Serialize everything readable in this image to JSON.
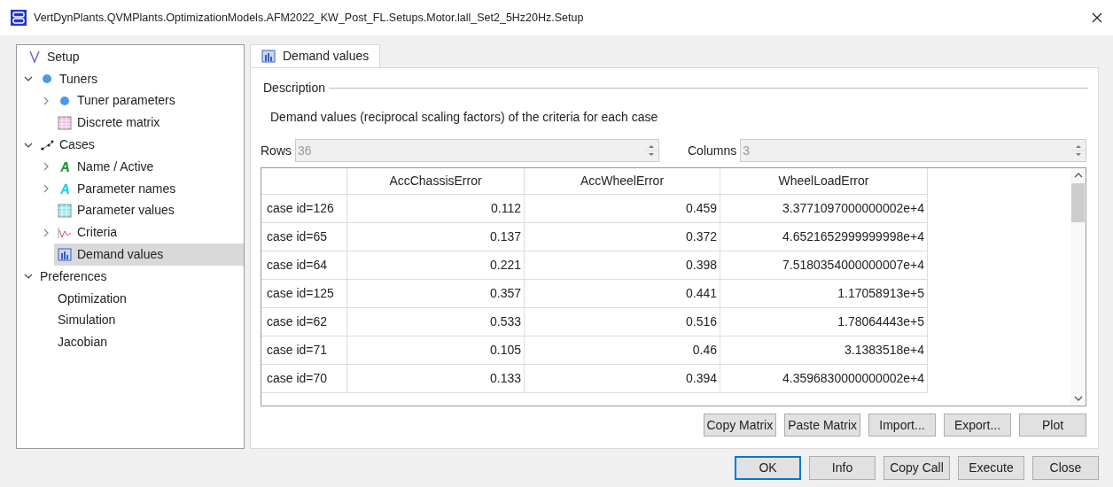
{
  "window": {
    "title": "VertDynPlants.QVMPlants.OptimizationModels.AFM2022_KW_Post_FL.Setups.Motor.lall_Set2_5Hz20Hz.Setup"
  },
  "tree": [
    {
      "label": "Setup",
      "kind": "setup",
      "selected": false
    },
    {
      "label": "Tuners",
      "kind": "tuners",
      "expanded": true,
      "selected": false,
      "children": [
        {
          "label": "Tuner parameters",
          "kind": "tuners",
          "expanded": false,
          "selected": false
        },
        {
          "label": "Discrete matrix",
          "kind": "matrix",
          "selected": false
        }
      ]
    },
    {
      "label": "Cases",
      "kind": "cases",
      "expanded": true,
      "selected": false,
      "children": [
        {
          "label": "Name / Active",
          "kind": "names",
          "expanded": false,
          "selected": false
        },
        {
          "label": "Parameter names",
          "kind": "parameters",
          "expanded": false,
          "selected": false
        },
        {
          "label": "Parameter values",
          "kind": "values",
          "selected": false
        },
        {
          "label": "Criteria",
          "kind": "criteria",
          "expanded": false,
          "selected": false
        },
        {
          "label": "Demand values",
          "kind": "demand",
          "selected": true
        }
      ]
    },
    {
      "label": "Preferences",
      "kind": "plain",
      "expanded": true,
      "selected": false,
      "children": [
        {
          "label": "Optimization",
          "kind": "plain",
          "selected": false
        },
        {
          "label": "Simulation",
          "kind": "plain",
          "selected": false
        },
        {
          "label": "Jacobian",
          "kind": "plain",
          "selected": false
        }
      ]
    }
  ],
  "tabs": [
    {
      "label": "Demand values",
      "selected": true
    }
  ],
  "description": {
    "heading": "Description",
    "text": "Demand values (reciprocal scaling factors) of the criteria for each case"
  },
  "rows_field": {
    "label": "Rows",
    "value": "36"
  },
  "columns_field": {
    "label": "Columns",
    "value": "3"
  },
  "table": {
    "columns": [
      "AccChassisError",
      "AccWheelError",
      "WheelLoadError"
    ],
    "rows": [
      {
        "header": "case id=126",
        "cells": [
          "0.112",
          "0.459",
          "3.3771097000000002e+4"
        ]
      },
      {
        "header": "case id=65",
        "cells": [
          "0.137",
          "0.372",
          "4.6521652999999998e+4"
        ]
      },
      {
        "header": "case id=64",
        "cells": [
          "0.221",
          "0.398",
          "7.5180354000000007e+4"
        ]
      },
      {
        "header": "case id=125",
        "cells": [
          "0.357",
          "0.441",
          "1.17058913e+5"
        ]
      },
      {
        "header": "case id=62",
        "cells": [
          "0.533",
          "0.516",
          "1.78064443e+5"
        ]
      },
      {
        "header": "case id=71",
        "cells": [
          "0.105",
          "0.46",
          "3.1383518e+4"
        ]
      },
      {
        "header": "case id=70",
        "cells": [
          "0.133",
          "0.394",
          "4.3596830000000002e+4"
        ]
      }
    ]
  },
  "matrix_buttons": [
    "Copy Matrix",
    "Paste Matrix",
    "Import...",
    "Export...",
    "Plot"
  ],
  "dialog_buttons": [
    {
      "label": "OK",
      "default": true
    },
    {
      "label": "Info",
      "default": false
    },
    {
      "label": "Copy Call",
      "default": false
    },
    {
      "label": "Execute",
      "default": false
    },
    {
      "label": "Close",
      "default": false
    }
  ]
}
